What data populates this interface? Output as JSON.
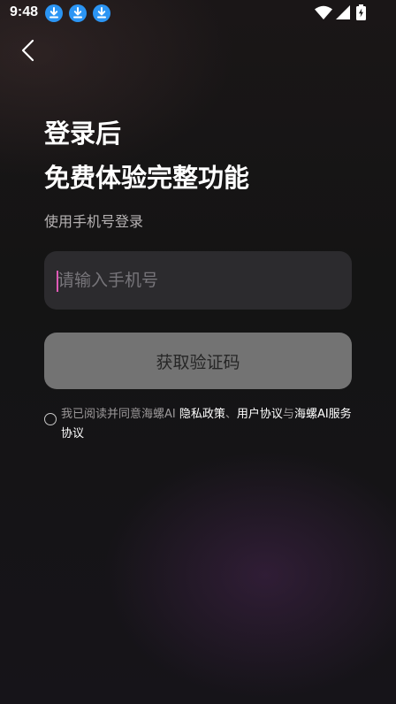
{
  "status_bar": {
    "time": "9:48",
    "notification_icons": [
      "download-icon",
      "download-icon",
      "download-icon"
    ],
    "system_icons": [
      "wifi-icon",
      "signal-icon",
      "battery-charging-icon"
    ],
    "accent_color": "#2b95f4"
  },
  "header": {
    "back_icon": "chevron-left-icon"
  },
  "login": {
    "title_line1": "登录后",
    "title_line2": "免费体验完整功能",
    "subtitle": "使用手机号登录",
    "phone_placeholder": "请输入手机号",
    "phone_value": "",
    "get_code_label": "获取验证码"
  },
  "agreement": {
    "checked": false,
    "prefix": "我已阅读并同意海螺AI ",
    "privacy_link": "隐私政策",
    "separator": "、",
    "user_link": "用户协议",
    "conjunction": "与",
    "service_link": "海螺AI服务协议"
  },
  "colors": {
    "background": "#141414",
    "input_bg": "#2c2b2e",
    "button_bg": "#737373",
    "caret": "#e05ab6"
  }
}
